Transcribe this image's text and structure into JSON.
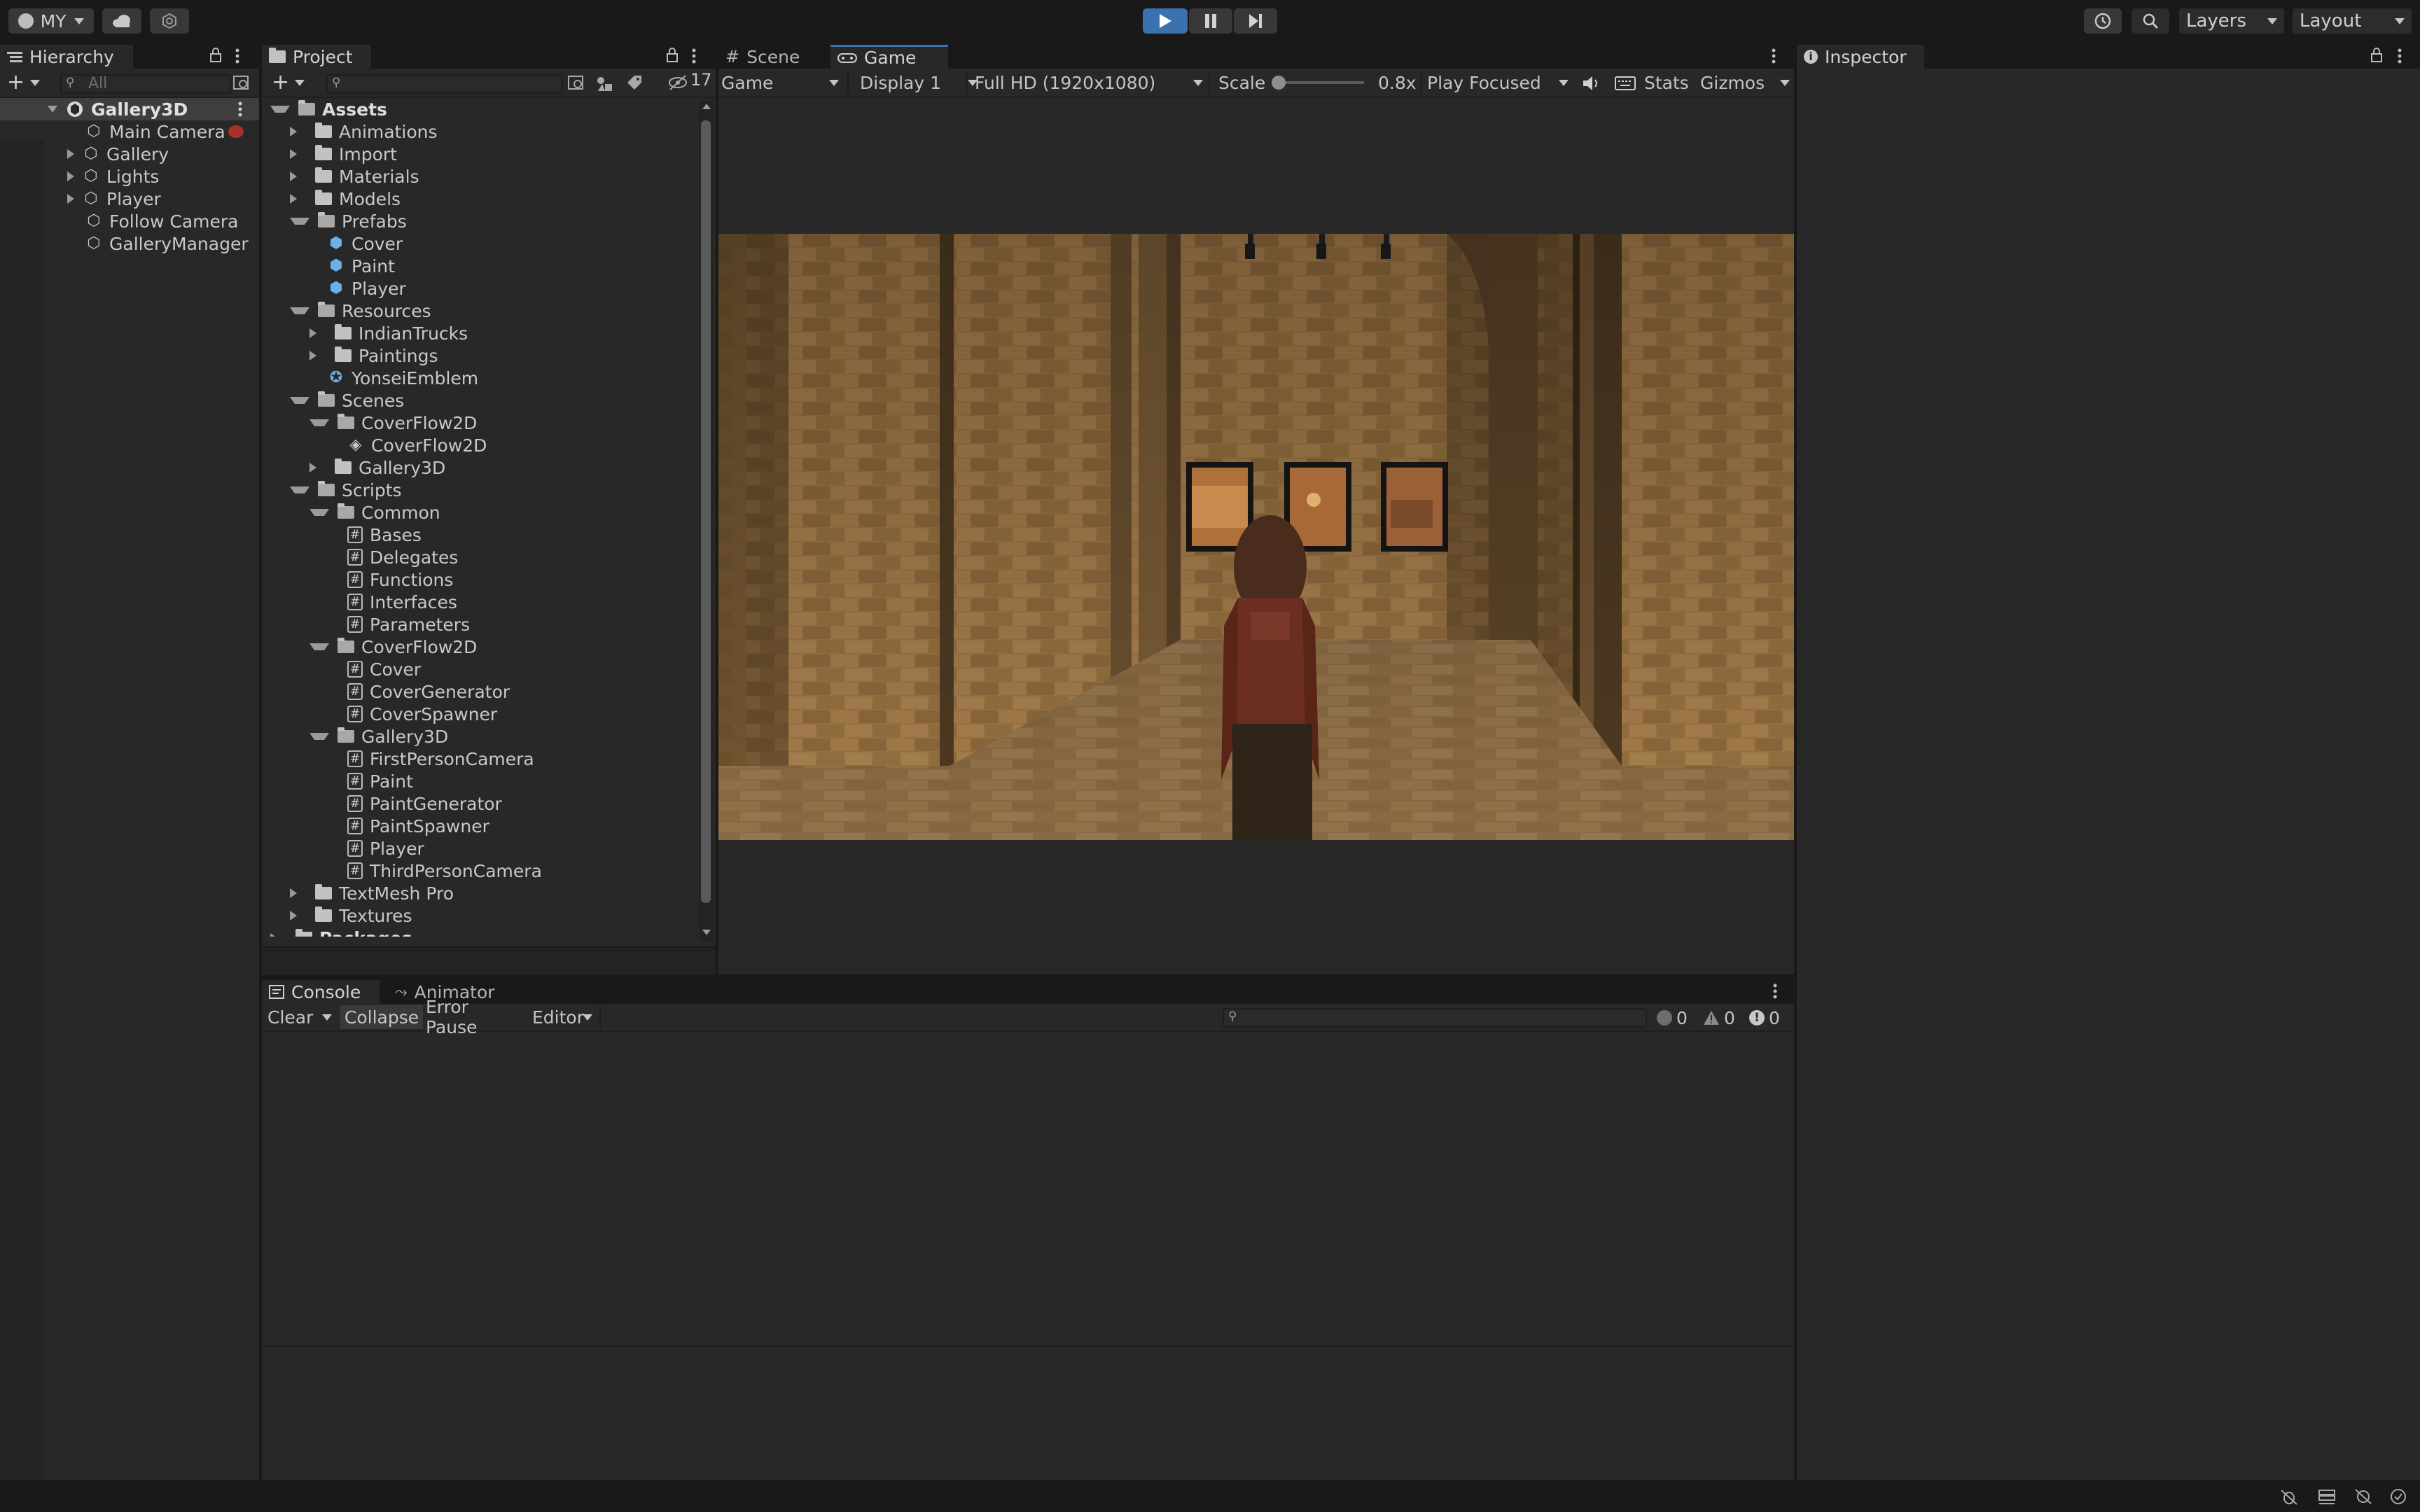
{
  "toolbar": {
    "account": "MY",
    "layers": "Layers",
    "layout": "Layout"
  },
  "hierarchy": {
    "tab": "Hierarchy",
    "search_placeholder": "All",
    "root": "Gallery3D",
    "items": [
      "Main Camera",
      "Gallery",
      "Lights",
      "Player",
      "Follow Camera",
      "GalleryManager"
    ]
  },
  "project": {
    "tab": "Project",
    "hidden_count": "17",
    "tree": [
      {
        "label": "Assets",
        "depth": 0,
        "kind": "folder-open",
        "bold": true
      },
      {
        "label": "Animations",
        "depth": 1,
        "kind": "folder"
      },
      {
        "label": "Import",
        "depth": 1,
        "kind": "folder"
      },
      {
        "label": "Materials",
        "depth": 1,
        "kind": "folder"
      },
      {
        "label": "Models",
        "depth": 1,
        "kind": "folder"
      },
      {
        "label": "Prefabs",
        "depth": 1,
        "kind": "folder-open"
      },
      {
        "label": "Cover",
        "depth": 2,
        "kind": "prefab"
      },
      {
        "label": "Paint",
        "depth": 2,
        "kind": "prefab"
      },
      {
        "label": "Player",
        "depth": 2,
        "kind": "prefab"
      },
      {
        "label": "Resources",
        "depth": 1,
        "kind": "folder-open"
      },
      {
        "label": "IndianTrucks",
        "depth": 2,
        "kind": "folder"
      },
      {
        "label": "Paintings",
        "depth": 2,
        "kind": "folder"
      },
      {
        "label": "YonseiEmblem",
        "depth": 2,
        "kind": "emblem"
      },
      {
        "label": "Scenes",
        "depth": 1,
        "kind": "folder-open"
      },
      {
        "label": "CoverFlow2D",
        "depth": 2,
        "kind": "folder-open"
      },
      {
        "label": "CoverFlow2D",
        "depth": 3,
        "kind": "scene"
      },
      {
        "label": "Gallery3D",
        "depth": 2,
        "kind": "folder"
      },
      {
        "label": "Scripts",
        "depth": 1,
        "kind": "folder-open"
      },
      {
        "label": "Common",
        "depth": 2,
        "kind": "folder-open"
      },
      {
        "label": "Bases",
        "depth": 3,
        "kind": "script"
      },
      {
        "label": "Delegates",
        "depth": 3,
        "kind": "script"
      },
      {
        "label": "Functions",
        "depth": 3,
        "kind": "script"
      },
      {
        "label": "Interfaces",
        "depth": 3,
        "kind": "script"
      },
      {
        "label": "Parameters",
        "depth": 3,
        "kind": "script"
      },
      {
        "label": "CoverFlow2D",
        "depth": 2,
        "kind": "folder-open"
      },
      {
        "label": "Cover",
        "depth": 3,
        "kind": "script"
      },
      {
        "label": "CoverGenerator",
        "depth": 3,
        "kind": "script"
      },
      {
        "label": "CoverSpawner",
        "depth": 3,
        "kind": "script"
      },
      {
        "label": "Gallery3D",
        "depth": 2,
        "kind": "folder-open"
      },
      {
        "label": "FirstPersonCamera",
        "depth": 3,
        "kind": "script"
      },
      {
        "label": "Paint",
        "depth": 3,
        "kind": "script"
      },
      {
        "label": "PaintGenerator",
        "depth": 3,
        "kind": "script"
      },
      {
        "label": "PaintSpawner",
        "depth": 3,
        "kind": "script"
      },
      {
        "label": "Player",
        "depth": 3,
        "kind": "script"
      },
      {
        "label": "ThirdPersonCamera",
        "depth": 3,
        "kind": "script"
      },
      {
        "label": "TextMesh Pro",
        "depth": 1,
        "kind": "folder"
      },
      {
        "label": "Textures",
        "depth": 1,
        "kind": "folder"
      },
      {
        "label": "Packages",
        "depth": 0,
        "kind": "folder",
        "bold": true
      }
    ]
  },
  "view": {
    "tab_scene": "Scene",
    "tab_game": "Game",
    "game_dropdown": "Game",
    "display": "Display 1",
    "resolution": "Full HD (1920x1080)",
    "scale_label": "Scale",
    "scale_value": "0.8x",
    "play_mode": "Play Focused",
    "stats": "Stats",
    "gizmos": "Gizmos"
  },
  "inspector": {
    "tab": "Inspector"
  },
  "console": {
    "tab": "Console",
    "tab_animator": "Animator",
    "clear": "Clear",
    "collapse": "Collapse",
    "error_pause": "Error Pause",
    "editor": "Editor",
    "count_log": "0",
    "count_warn": "0",
    "count_error": "0"
  },
  "colors": {
    "accent": "#3a72b0",
    "panel": "#282828",
    "chrome": "#191919"
  }
}
